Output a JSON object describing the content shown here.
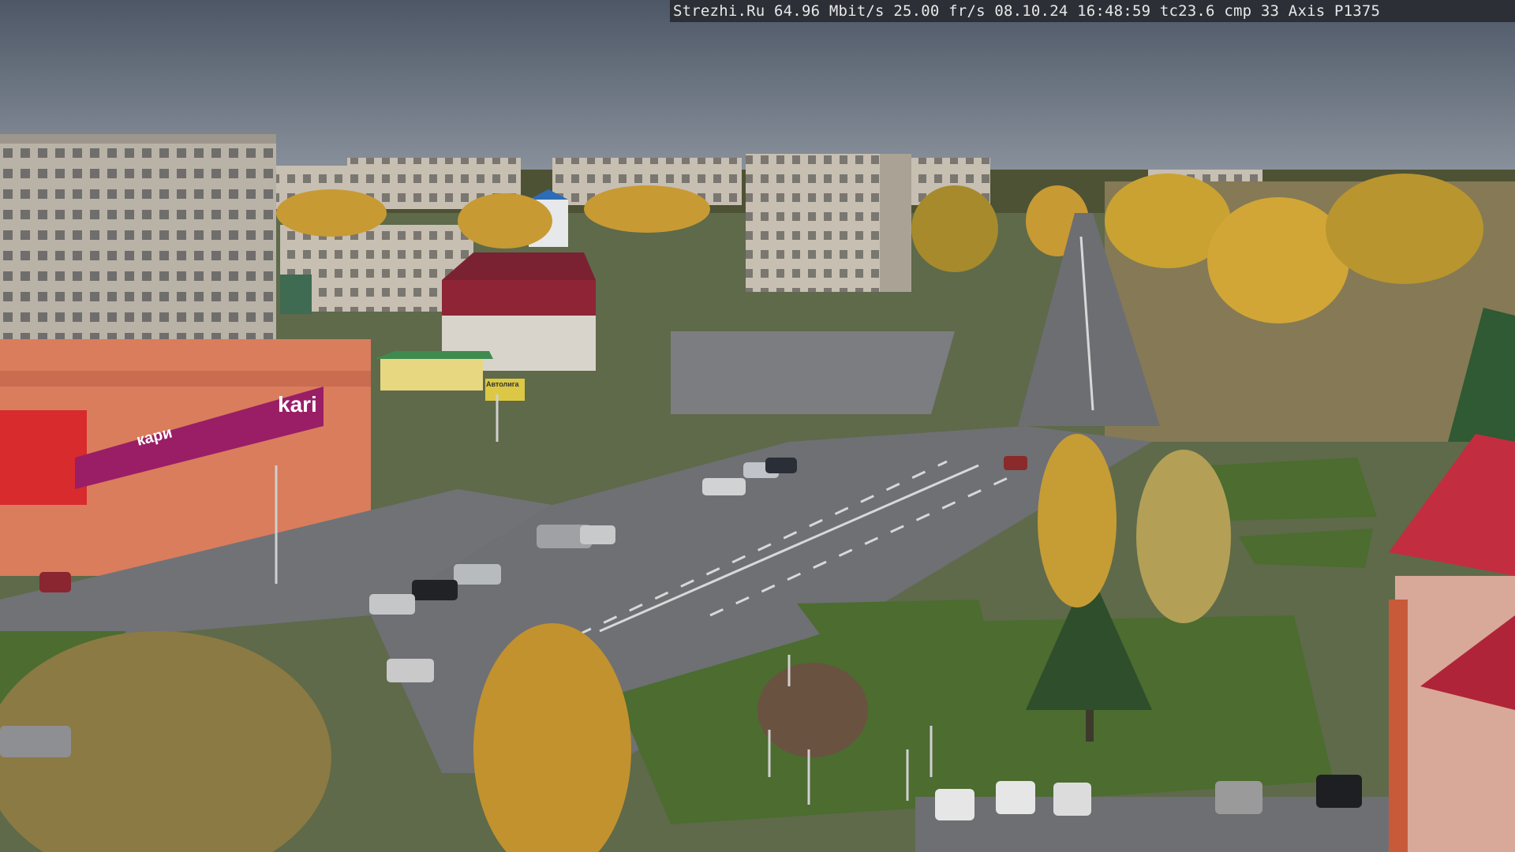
{
  "overlay": {
    "text": "Strezhi.Ru 64.96 Mbit/s 25.00 fr/s 08.10.24 16:48:59  tc23.6  cmp 33   Axis P1375"
  },
  "signs": {
    "kari_logo": "kari",
    "kari_banner": "кари",
    "market_sign": "Автолига"
  },
  "colors": {
    "sky_top": "#4f5968",
    "sky_bottom": "#8a929c",
    "asphalt": "#6b6e73",
    "grass": "#4f6e34",
    "foliage": "#c79a2e",
    "kari_magenta": "#9a1e66",
    "roof_red": "#b0243a"
  }
}
